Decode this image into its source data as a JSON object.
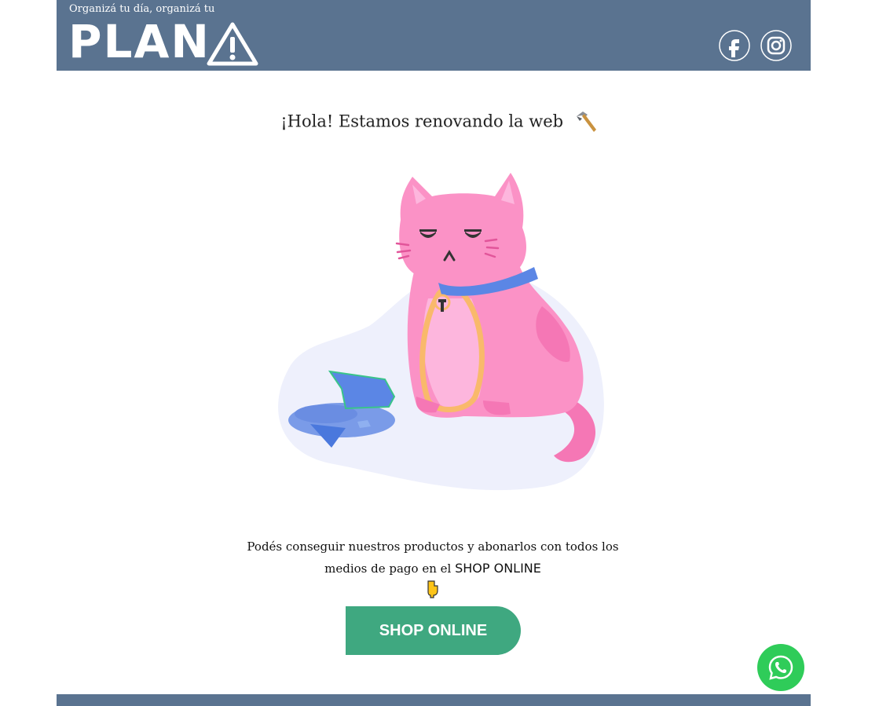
{
  "header": {
    "tagline": "Organizá tu día, organizá tu",
    "logo_text": "PLAN",
    "logo_icon": "warning-triangle-icon",
    "social": [
      {
        "name": "facebook-icon"
      },
      {
        "name": "instagram-icon"
      }
    ]
  },
  "main": {
    "headline": "¡Hola! Estamos renovando la web",
    "headline_icon": "hammer-icon",
    "illustration": "sad-cat-broken-vase-illustration",
    "description_part1": "Podés conseguir nuestros productos y abonarlos con todos los medios de pago en el",
    "description_link": "SHOP ONLINE",
    "pointer_icon": "pointing-down-hand-icon",
    "shop_button_label": "SHOP ONLINE"
  },
  "floating": {
    "whatsapp_icon": "whatsapp-icon"
  },
  "colors": {
    "header_bg": "#5a7390",
    "button_green": "#3fa880",
    "whatsapp_green": "#2fcc59",
    "cat_pink": "#fb92c6",
    "collar_blue": "#5b86e5"
  }
}
